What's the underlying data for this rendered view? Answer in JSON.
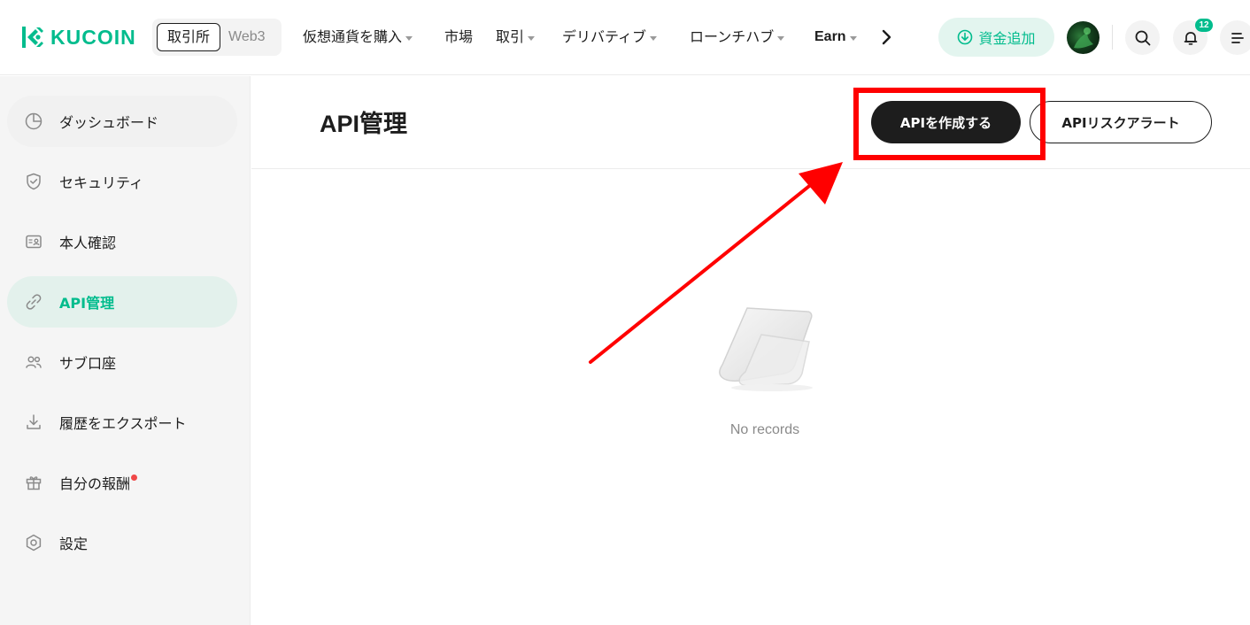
{
  "header": {
    "brand": "KUCOIN",
    "brand_color": "#01bc8d",
    "mode_switch": {
      "active": "取引所",
      "other": "Web3"
    },
    "nav": [
      {
        "label": "仮想通貨を購入",
        "dropdown": true
      },
      {
        "label": "市場",
        "dropdown": false
      },
      {
        "label": "取引",
        "dropdown": true
      },
      {
        "label": "デリバティブ",
        "dropdown": true
      },
      {
        "label": "ローンチハブ",
        "dropdown": true
      },
      {
        "label": "Earn",
        "dropdown": true
      }
    ],
    "more_icon": "chevron-right-icon",
    "deposit_label": "資金追加",
    "notification_count": "12"
  },
  "sidebar": {
    "items": [
      {
        "label": "ダッシュボード",
        "icon": "pie-chart-icon"
      },
      {
        "label": "セキュリティ",
        "icon": "shield-icon"
      },
      {
        "label": "本人確認",
        "icon": "id-card-icon"
      },
      {
        "label": "API管理",
        "icon": "link-icon",
        "active": true
      },
      {
        "label": "サブ口座",
        "icon": "users-icon"
      },
      {
        "label": "履歴をエクスポート",
        "icon": "download-icon"
      },
      {
        "label": "自分の報酬",
        "icon": "gift-icon",
        "has_dot": true
      },
      {
        "label": "設定",
        "icon": "settings-icon"
      }
    ],
    "active_color": "#01bc8d"
  },
  "main": {
    "title": "API管理",
    "create_button": "APIを作成する",
    "alert_button": "APIリスクアラート",
    "empty_text": "No records"
  },
  "annotation": {
    "color": "#ff0000"
  }
}
